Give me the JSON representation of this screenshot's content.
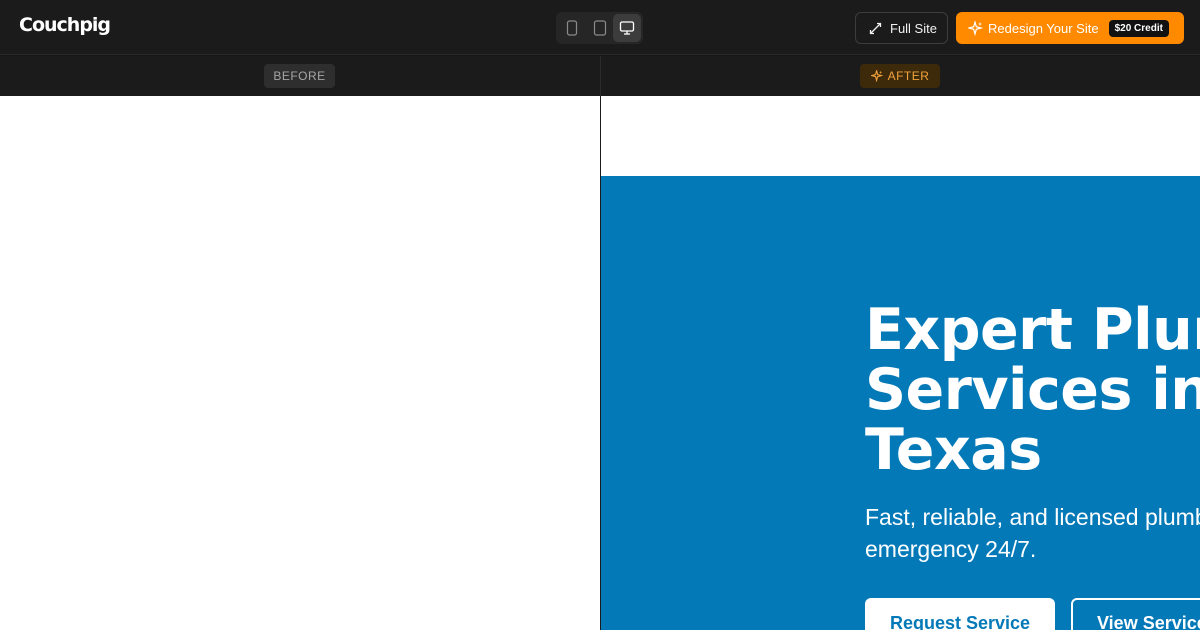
{
  "app": {
    "logo": "Couchpig"
  },
  "toolbar": {
    "devices": [
      {
        "name": "mobile",
        "icon": "phone-icon"
      },
      {
        "name": "tablet",
        "icon": "tablet-icon"
      },
      {
        "name": "desktop",
        "icon": "monitor-icon",
        "active": true
      }
    ],
    "full_site_label": "Full Site",
    "redesign_label": "Redesign Your Site",
    "credit_label": "$20 Credit",
    "accent_color": "#ff8a00"
  },
  "compare": {
    "before_label": "BEFORE",
    "after_label": "AFTER"
  },
  "preview": {
    "hero_title_lines": [
      "Expert Plumbing",
      "Services in",
      "Texas"
    ],
    "hero_subtitle_lines": [
      "Fast, reliable, and licensed plumbing",
      "emergency 24/7."
    ],
    "primary_button": "Request Service",
    "secondary_button": "View Services",
    "hero_color": "#0479b8"
  }
}
